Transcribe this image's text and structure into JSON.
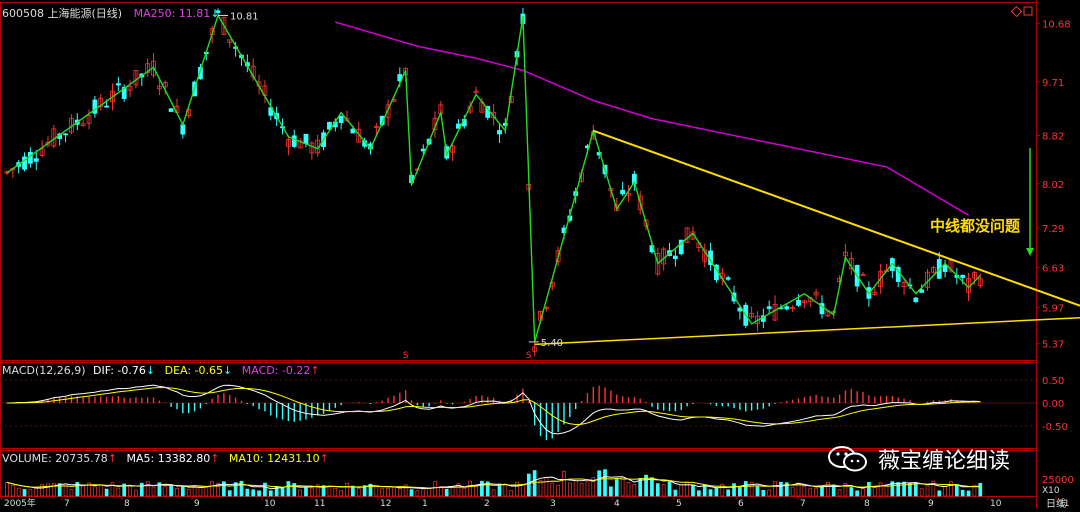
{
  "header": {
    "code": "600508",
    "name": "上海能源(日线)",
    "ma_label": "MA250: 11.81",
    "ma_arrow": "↓"
  },
  "macd_header": {
    "label": "MACD(12,26,9)",
    "dif": "DIF: -0.76",
    "dif_arrow": "↓",
    "dea": "DEA: -0.65",
    "dea_arrow": "↓",
    "macd": "MACD: -0.22",
    "macd_arrow": "↑"
  },
  "vol_header": {
    "volume": "VOLUME: 20735.78",
    "volume_arrow": "↑",
    "ma5": "MA5: 13382.80",
    "ma5_arrow": "↑",
    "ma10": "MA10: 12431.10",
    "ma10_arrow": "↑"
  },
  "annotation": "中线都没问题",
  "watermark": "薇宝缠论细读",
  "bottom_right_label": "日线",
  "colors": {
    "up": "#ff3232",
    "down": "#33ffff",
    "zigzag": "#22dd22",
    "trend": "#ffdd00",
    "ma250": "#d000d0",
    "axis": "#b00000",
    "dif": "#ffffff",
    "dea": "#ffff00"
  },
  "chart_data": {
    "type": "candlestick",
    "ylim": [
      5.2,
      10.9
    ],
    "y_ticks": [
      "10.68",
      "9.71",
      "8.82",
      "8.02",
      "7.29",
      "6.63",
      "5.97",
      "5.37"
    ],
    "macd_ticks": [
      "0.50",
      "0.00",
      "-0.50"
    ],
    "volume_ticks": [
      "25000",
      "X10"
    ],
    "x_ticks": [
      "2005年",
      "7",
      "8",
      "9",
      "10",
      "11",
      "12",
      "1",
      "2",
      "3",
      "4",
      "5",
      "6",
      "7",
      "8",
      "9",
      "10",
      "11"
    ],
    "price_labels": [
      {
        "text": "10.81",
        "x_index": 36,
        "price": 10.81
      },
      {
        "text": "5.40",
        "x_index": 89,
        "price": 5.4
      }
    ],
    "ma250": {
      "points": [
        [
          56,
          10.7
        ],
        [
          70,
          10.3
        ],
        [
          80,
          10.1
        ],
        [
          88,
          9.9
        ],
        [
          100,
          9.4
        ],
        [
          110,
          9.1
        ],
        [
          130,
          8.7
        ],
        [
          150,
          8.3
        ],
        [
          164,
          7.5
        ]
      ]
    },
    "zigzag": [
      [
        0,
        8.2
      ],
      [
        25,
        9.95
      ],
      [
        30,
        9.0
      ],
      [
        36,
        10.81
      ],
      [
        48,
        8.8
      ],
      [
        53,
        8.6
      ],
      [
        57,
        9.2
      ],
      [
        62,
        8.6
      ],
      [
        68,
        9.9
      ],
      [
        69,
        8.0
      ],
      [
        74,
        9.2
      ],
      [
        75,
        8.5
      ],
      [
        80,
        9.5
      ],
      [
        85,
        8.9
      ],
      [
        88,
        10.8
      ],
      [
        90,
        5.4
      ],
      [
        100,
        8.9
      ],
      [
        104,
        7.6
      ],
      [
        107,
        8.05
      ],
      [
        111,
        6.7
      ],
      [
        117,
        7.2
      ],
      [
        127,
        5.7
      ],
      [
        136,
        6.2
      ],
      [
        141,
        5.85
      ],
      [
        143,
        6.8
      ],
      [
        147,
        6.2
      ],
      [
        151,
        6.7
      ],
      [
        155,
        6.2
      ],
      [
        160,
        6.7
      ],
      [
        164,
        6.3
      ],
      [
        166,
        6.5
      ]
    ],
    "trendlines": [
      {
        "from": [
          100,
          8.9
        ],
        "to": [
          174,
          6.0
        ]
      },
      {
        "from": [
          90,
          5.36
        ],
        "to": [
          174,
          5.8
        ]
      }
    ],
    "signal_marks": [
      {
        "text": "S",
        "x_index": 68
      },
      {
        "text": "S",
        "x_index": 89
      }
    ]
  }
}
